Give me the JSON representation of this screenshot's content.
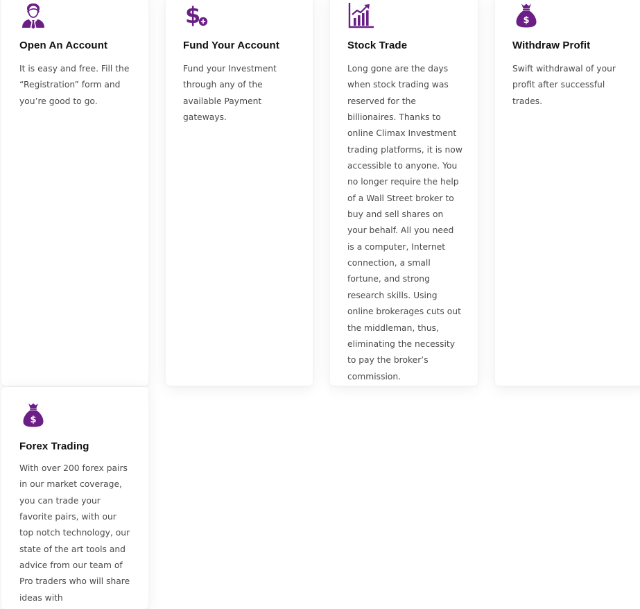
{
  "accent_color": "#6b1e86",
  "cards": [
    {
      "icon": "businessman-icon",
      "title": "Open An Account",
      "text": "It is easy and free. Fill the “Registration” form and you’re good to go."
    },
    {
      "icon": "dollar-plus-icon",
      "title": "Fund Your Account",
      "text": "Fund your Investment through any of the available Payment gateways."
    },
    {
      "icon": "growth-chart-icon",
      "title": "Stock Trade",
      "text": "Long gone are the days when stock trading was reserved for the billionaires. Thanks to online Climax Investment trading platforms, it is now accessible to anyone. You no longer require the help of a Wall Street broker to buy and sell shares on your behalf. All you need is a computer, Internet connection, a small fortune, and strong research skills. Using online brokerages cuts out the middleman, thus, eliminating the necessity to pay the broker’s commission."
    },
    {
      "icon": "money-bag-icon",
      "title": "Withdraw Profit",
      "text": "Swift withdrawal of your profit after successful trades."
    },
    {
      "icon": "money-bag-icon",
      "title": "Forex Trading",
      "text": "With over 200 forex pairs in our market coverage, you can trade your favorite pairs, with our top notch technology, our state of the art tools and advice from our team of Pro traders who will share ideas with"
    }
  ]
}
